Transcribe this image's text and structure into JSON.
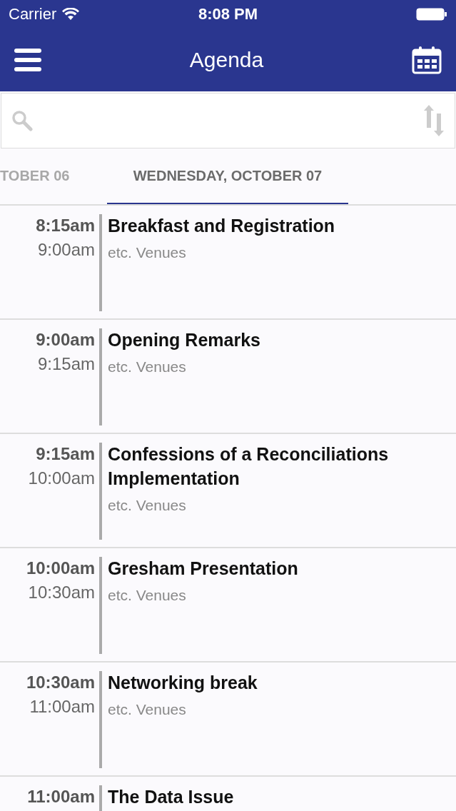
{
  "status_bar": {
    "carrier": "Carrier",
    "time": "8:08 PM"
  },
  "nav": {
    "title": "Agenda"
  },
  "day_tabs": [
    {
      "label": "TOBER 06",
      "selected": false
    },
    {
      "label": "WEDNESDAY, OCTOBER 07",
      "selected": true
    }
  ],
  "sessions": [
    {
      "start": "8:15am",
      "end": "9:00am",
      "title": "Breakfast and Registration",
      "venue": "etc. Venues"
    },
    {
      "start": "9:00am",
      "end": "9:15am",
      "title": "Opening Remarks",
      "venue": "etc. Venues"
    },
    {
      "start": "9:15am",
      "end": "10:00am",
      "title": "Confessions of a Reconciliations Implementation",
      "venue": "etc. Venues"
    },
    {
      "start": "10:00am",
      "end": "10:30am",
      "title": "Gresham Presentation",
      "venue": "etc. Venues"
    },
    {
      "start": "10:30am",
      "end": "11:00am",
      "title": "Networking break",
      "venue": "etc. Venues"
    },
    {
      "start": "11:00am",
      "title": "The Data Issue"
    }
  ]
}
